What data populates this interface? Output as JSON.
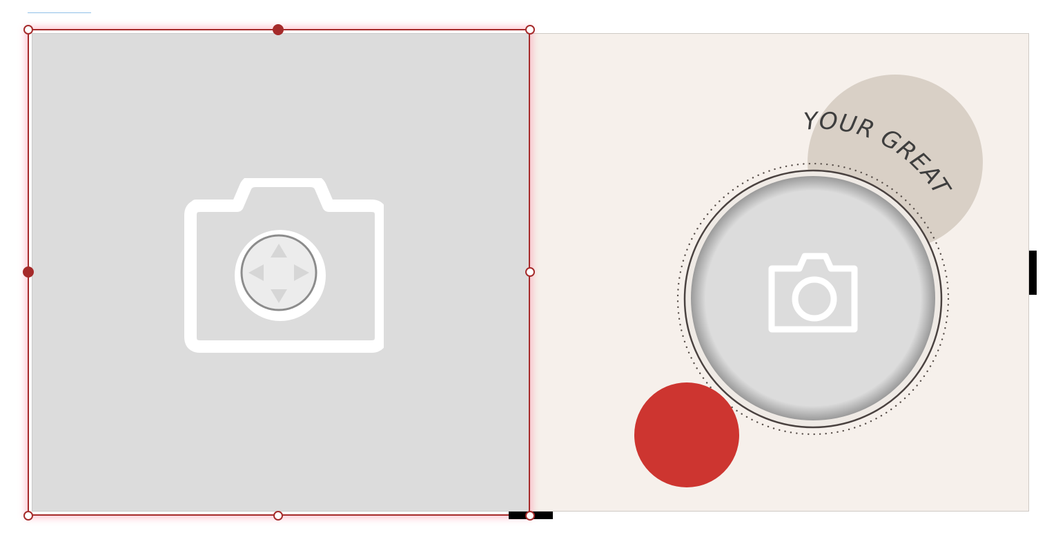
{
  "photo_text": {
    "headline": "YOUR GREAT TEXT"
  },
  "colors": {
    "selection": "#a52a2a",
    "placeholder_gray": "#dcdcdc",
    "right_page_bg": "#f6f0eb",
    "beige_circle": "#d9d0c6",
    "red_circle": "#cd3530"
  },
  "icons": {
    "left_placeholder": "camera-icon",
    "right_placeholder": "camera-icon",
    "move_control": "move-arrows-icon"
  }
}
